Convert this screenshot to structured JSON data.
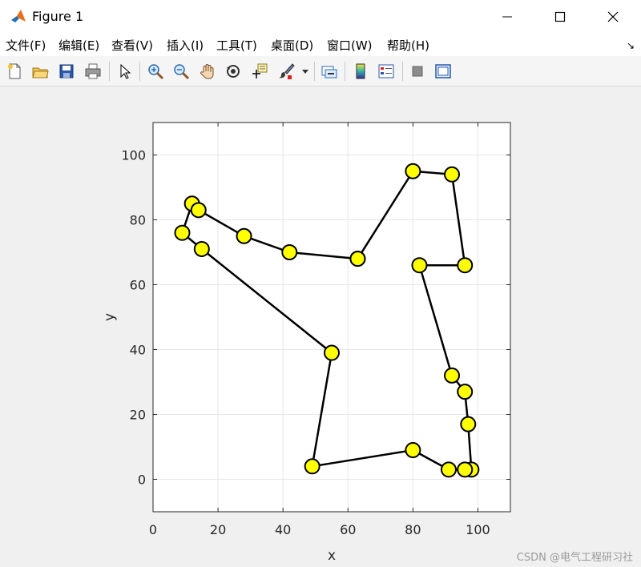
{
  "window": {
    "title": "Figure 1",
    "controls": {
      "minimize": "—",
      "maximize": "☐",
      "close": "✕"
    }
  },
  "menu": [
    "文件(F)",
    "编辑(E)",
    "查看(V)",
    "插入(I)",
    "工具(T)",
    "桌面(D)",
    "窗口(W)",
    "帮助(H)"
  ],
  "menu_overflow_arrow": "↘",
  "toolbar": {
    "buttons": [
      "new-figure-icon",
      "open-file-icon",
      "save-icon",
      "print-icon",
      "edit-plot-icon",
      "zoom-in-icon",
      "zoom-out-icon",
      "pan-hand-icon",
      "rotate-3d-icon",
      "data-cursor-icon",
      "brush-icon",
      "link-plot-icon",
      "colorbar-icon",
      "legend-icon",
      "hide-plot-tools-icon",
      "show-plot-tools-icon"
    ]
  },
  "colors": {
    "marker_fill": "#ffff00",
    "marker_edge": "#000000",
    "line": "#000000",
    "grid": "#e6e6e6",
    "axes_bg": "#ffffff"
  },
  "chart_data": {
    "type": "line",
    "xlabel": "x",
    "ylabel": "y",
    "xlim": [
      0,
      110
    ],
    "ylim": [
      -10,
      110
    ],
    "xticks": [
      0,
      20,
      40,
      60,
      80,
      100
    ],
    "yticks": [
      0,
      20,
      40,
      60,
      80,
      100
    ],
    "grid": true,
    "marker": "circle",
    "series": [
      {
        "x": [
          63,
          80,
          92,
          96,
          82,
          92,
          96,
          97,
          98,
          96,
          91,
          80,
          49,
          55,
          15,
          9,
          12,
          14,
          28,
          42,
          63
        ],
        "y": [
          68,
          95,
          94,
          66,
          66,
          32,
          27,
          17,
          3,
          3,
          3,
          9,
          4,
          39,
          71,
          76,
          85,
          83,
          75,
          70,
          68
        ]
      }
    ]
  },
  "watermark": "CSDN @电气工程研习社"
}
